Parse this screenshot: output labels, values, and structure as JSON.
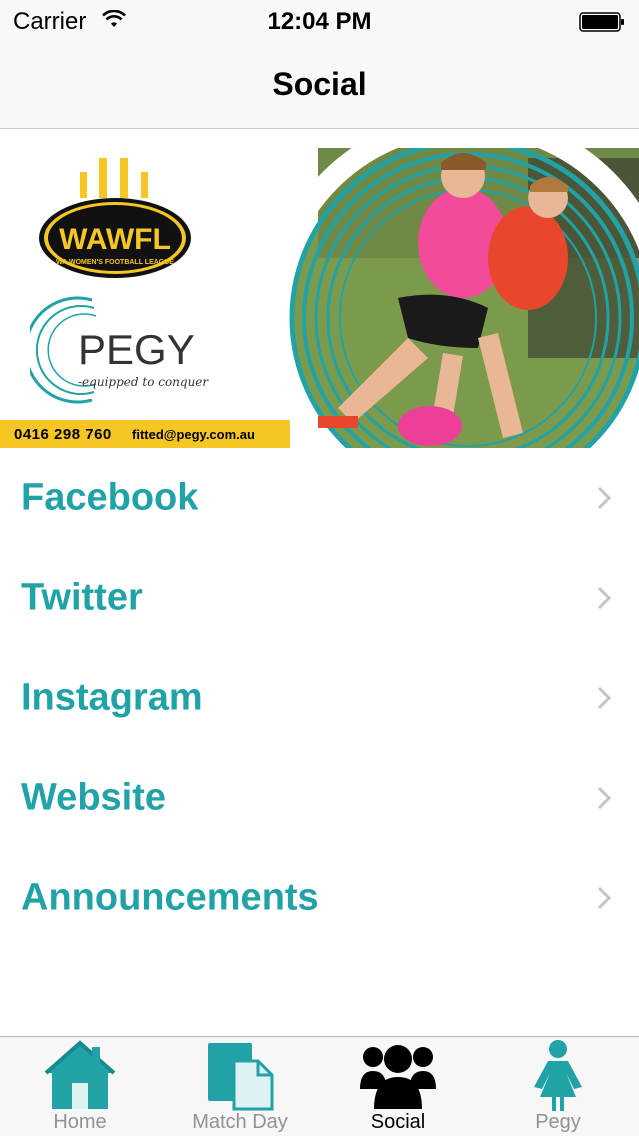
{
  "status_bar": {
    "carrier": "Carrier",
    "time": "12:04 PM",
    "wifi_icon": "wifi-icon",
    "battery_icon": "battery-icon"
  },
  "nav": {
    "title": "Social"
  },
  "banner": {
    "logo_text": "WAWFL",
    "logo_subtext": "WA WOMEN'S FOOTBALL LEAGUE",
    "brand_name": "PEGY",
    "brand_tagline": "equipped to conquer",
    "phone": "0416 298 760",
    "email": "fitted@pegy.com.au"
  },
  "list": {
    "items": [
      {
        "label": "Facebook"
      },
      {
        "label": "Twitter"
      },
      {
        "label": "Instagram"
      },
      {
        "label": "Website"
      },
      {
        "label": "Announcements"
      }
    ]
  },
  "tab_bar": {
    "tabs": [
      {
        "label": "Home",
        "icon": "home-icon"
      },
      {
        "label": "Match Day",
        "icon": "document-icon"
      },
      {
        "label": "Social",
        "icon": "people-icon"
      },
      {
        "label": "Pegy",
        "icon": "woman-icon"
      }
    ],
    "active": "Social"
  },
  "colors": {
    "accent": "#21a2a6",
    "strip": "#f6c624",
    "tab_inactive": "#929292",
    "chevron": "#c4c4c4"
  }
}
